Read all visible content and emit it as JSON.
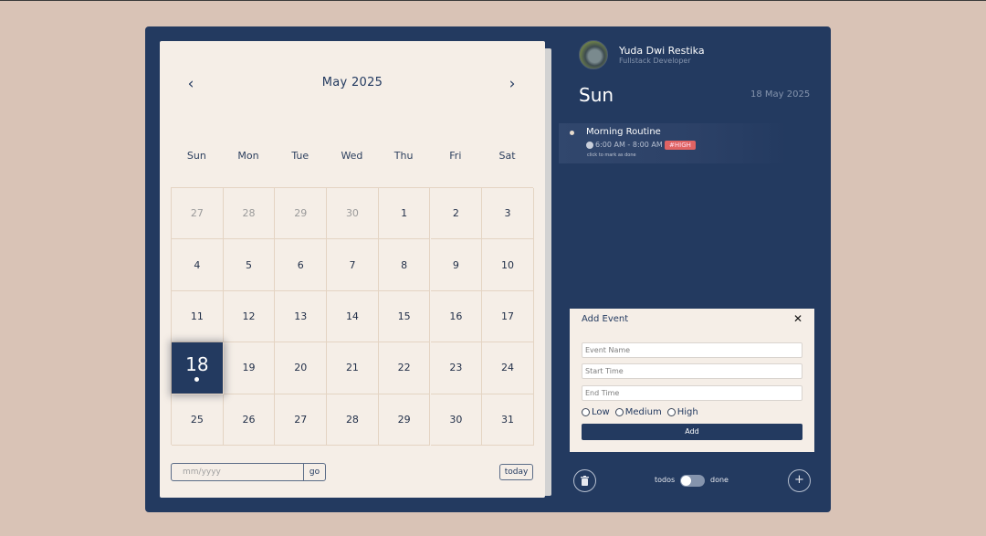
{
  "calendar": {
    "month_title": "May 2025",
    "prev_icon": "chevron-left-icon",
    "next_icon": "chevron-right-icon",
    "prev_glyph": "‹",
    "next_glyph": "›",
    "weekdays": [
      "Sun",
      "Mon",
      "Tue",
      "Wed",
      "Thu",
      "Fri",
      "Sat"
    ],
    "days": [
      {
        "label": "27",
        "muted": true
      },
      {
        "label": "28",
        "muted": true
      },
      {
        "label": "29",
        "muted": true
      },
      {
        "label": "30",
        "muted": true
      },
      {
        "label": "1"
      },
      {
        "label": "2"
      },
      {
        "label": "3"
      },
      {
        "label": "4"
      },
      {
        "label": "5"
      },
      {
        "label": "6"
      },
      {
        "label": "7"
      },
      {
        "label": "8"
      },
      {
        "label": "9"
      },
      {
        "label": "10"
      },
      {
        "label": "11"
      },
      {
        "label": "12"
      },
      {
        "label": "13"
      },
      {
        "label": "14"
      },
      {
        "label": "15"
      },
      {
        "label": "16"
      },
      {
        "label": "17"
      },
      {
        "label": "18",
        "selected": true,
        "has_event": true
      },
      {
        "label": "19"
      },
      {
        "label": "20"
      },
      {
        "label": "21"
      },
      {
        "label": "22"
      },
      {
        "label": "23"
      },
      {
        "label": "24"
      },
      {
        "label": "25"
      },
      {
        "label": "26"
      },
      {
        "label": "27"
      },
      {
        "label": "28"
      },
      {
        "label": "29"
      },
      {
        "label": "30"
      },
      {
        "label": "31"
      }
    ],
    "goto_placeholder": "mm/yyyy",
    "go_label": "go",
    "today_label": "today"
  },
  "user": {
    "name": "Yuda Dwi Restika",
    "role": "Fullstack Developer"
  },
  "selected_day": {
    "day_name": "Sun",
    "full_date": "18 May 2025"
  },
  "events": [
    {
      "title": "Morning Routine",
      "time": "6:00 AM - 8:00 AM",
      "priority_tag": "#HIGH",
      "hint": "click to mark as done"
    }
  ],
  "add_event": {
    "title": "Add Event",
    "close_glyph": "✕",
    "name_placeholder": "Event Name",
    "start_placeholder": "Start Time",
    "end_placeholder": "End Time",
    "priorities": [
      "Low",
      "Medium",
      "High"
    ],
    "add_label": "Add"
  },
  "footer": {
    "toggle_left": "todos",
    "toggle_right": "done",
    "plus_glyph": "+"
  },
  "colors": {
    "primary": "#233a60",
    "panel": "#f5eee7",
    "background": "#d9c3b6",
    "high_priority": "#e06363"
  }
}
